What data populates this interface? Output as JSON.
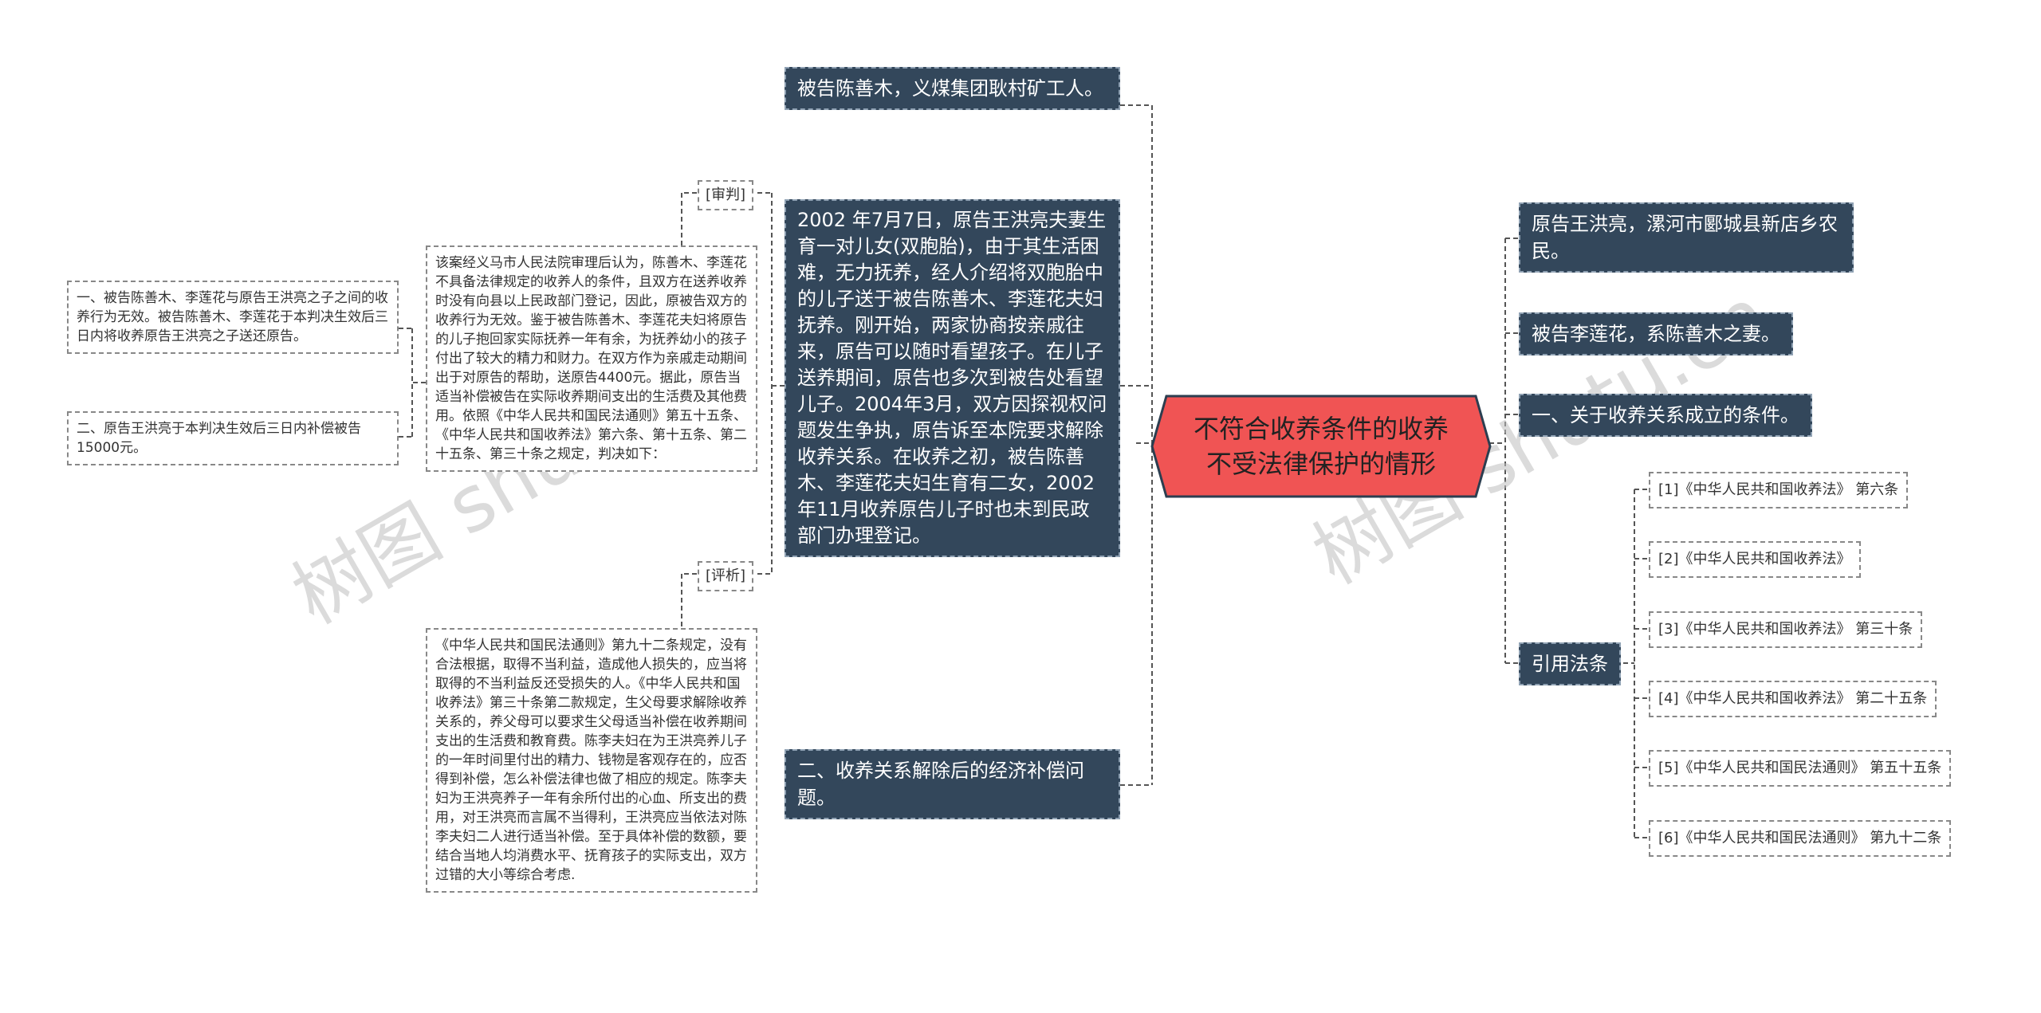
{
  "center": {
    "title": "不符合收养条件的收养不受法律保护的情形",
    "fill": "#f05454"
  },
  "left_main": [
    "被告陈善木，义煤集团耿村矿工人。",
    "2002 年7月7日，原告王洪亮夫妻生育一对儿女(双胞胎)，由于其生活困难，无力抚养，经人介绍将双胞胎中的儿子送于被告陈善木、李莲花夫妇抚养。刚开始，两家协商按亲戚往来，原告可以随时看望孩子。在儿子送养期间，原告也多次到被告处看望儿子。2004年3月，双方因探视权问题发生争执，原告诉至本院要求解除收养关系。在收养之初，被告陈善木、李莲花夫妇生育有二女，2002年11月收养原告儿子时也未到民政部门办理登记。",
    "二、收养关系解除后的经济补偿问题。"
  ],
  "tags": {
    "trial": "[审判]",
    "comment": "[评析]"
  },
  "trial_text": "该案经义马市人民法院审理后认为，陈善木、李莲花不具备法律规定的收养人的条件，且双方在送养收养时没有向县以上民政部门登记，因此，原被告双方的收养行为无效。鉴于被告陈善木、李莲花夫妇将原告的儿子抱回家实际抚养一年有余，为抚养幼小的孩子付出了较大的精力和财力。在双方作为亲戚走动期间出于对原告的帮助，送原告4400元。据此，原告当适当补偿被告在实际收养期间支出的生活费及其他费用。依照《中华人民共和国民法通则》第五十五条、《中华人民共和国收养法》第六条、第十五条、第二十五条、第三十条之规定，判决如下：",
  "verdicts": [
    "一、被告陈善木、李莲花与原告王洪亮之子之间的收养行为无效。被告陈善木、李莲花于本判决生效后三日内将收养原告王洪亮之子送还原告。",
    "二、原告王洪亮于本判决生效后三日内补偿被告15000元。"
  ],
  "comment_text": "《中华人民共和国民法通则》第九十二条规定，没有合法根据，取得不当利益，造成他人损失的，应当将取得的不当利益反还受损失的人。《中华人民共和国收养法》第三十条第二款规定，生父母要求解除收养关系的，养父母可以要求生父母适当补偿在收养期间支出的生活费和教育费。陈李夫妇在为王洪亮养儿子的一年时间里付出的精力、钱物是客观存在的，应否得到补偿，怎么补偿法律也做了相应的规定。陈李夫妇为王洪亮养子一年有余所付出的心血、所支出的费用，对王洪亮而言属不当得利，王洪亮应当依法对陈李夫妇二人进行适当补偿。至于具体补偿的数额，要结合当地人均消费水平、抚育孩子的实际支出，双方过错的大小等综合考虑.",
  "right_main": [
    "原告王洪亮，漯河市郾城县新店乡农民。",
    "被告李莲花，系陈善木之妻。",
    "一、关于收养关系成立的条件。",
    "引用法条"
  ],
  "laws": [
    "[1]《中华人民共和国收养法》 第六条",
    "[2]《中华人民共和国收养法》",
    "[3]《中华人民共和国收养法》 第三十条",
    "[4]《中华人民共和国收养法》 第二十五条",
    "[5]《中华人民共和国民法通则》 第五十五条",
    "[6]《中华人民共和国民法通则》 第九十二条"
  ],
  "watermark": "树图 shutu.cn",
  "colors": {
    "node_dark": "#33475b",
    "center": "#f05454",
    "line": "#555555"
  }
}
